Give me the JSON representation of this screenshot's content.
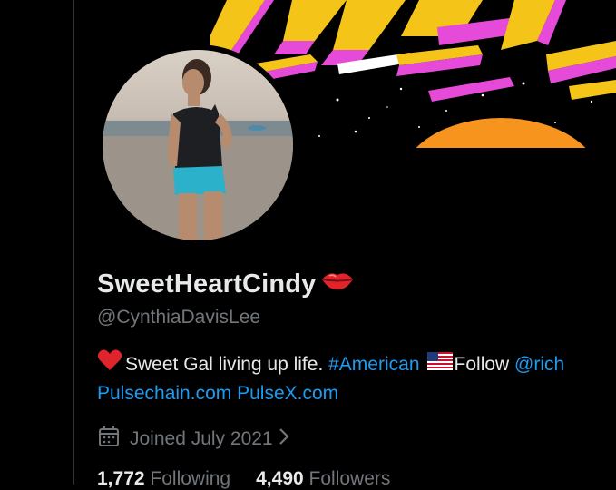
{
  "profile": {
    "display_name": "SweetHeartCindy",
    "name_emoji": "lips-emoji",
    "handle": "@CynthiaDavisLee"
  },
  "bio": {
    "line1_text": "Sweet Gal living up life.",
    "hashtag": "#American",
    "follow_text": "Follow",
    "mention": "@rich",
    "link1": "Pulsechain.com",
    "link2": "PulseX.com"
  },
  "joined": {
    "text": "Joined July 2021"
  },
  "stats": {
    "following_count": "1,772",
    "following_label": "Following",
    "followers_count": "4,490",
    "followers_label": "Followers"
  },
  "colors": {
    "background": "#000000",
    "text": "#e7e9ea",
    "muted": "#71767b",
    "link": "#1d9bf0"
  }
}
